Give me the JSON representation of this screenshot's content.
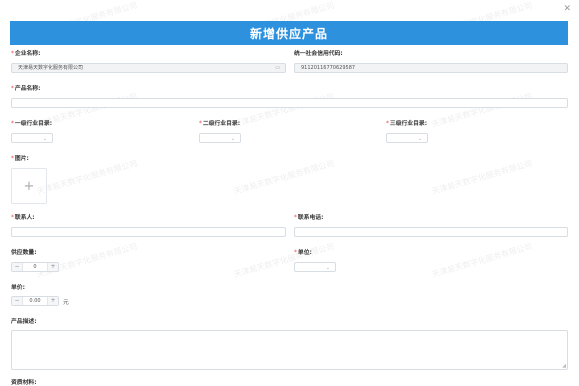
{
  "dialog": {
    "title": "新增供应产品",
    "close_icon": "close-icon"
  },
  "watermark": "天津易天数字化服务有限公司",
  "form": {
    "company_name": {
      "label": "企业名称:",
      "value": "天津易天数字化服务有限公司",
      "icon": "card-icon"
    },
    "credit_code": {
      "label": "统一社会信用代码:",
      "value": "91120116770629587"
    },
    "product_name": {
      "label": "产品名称:",
      "value": ""
    },
    "industry_level1": {
      "label": "一级行业目录:",
      "value": ""
    },
    "industry_level2": {
      "label": "二级行业目录:",
      "value": ""
    },
    "industry_level3": {
      "label": "三级行业目录:",
      "value": ""
    },
    "image": {
      "label": "图片:",
      "icon": "plus-icon"
    },
    "contact": {
      "label": "联系人:",
      "value": ""
    },
    "phone": {
      "label": "联系电话:",
      "value": ""
    },
    "supply_qty": {
      "label": "供应数量:",
      "value": "0",
      "minus": "−",
      "plus": "+"
    },
    "unit": {
      "label": "单位:",
      "value": ""
    },
    "price": {
      "label": "单价:",
      "value": "0.00",
      "minus": "−",
      "plus": "+",
      "suffix": "元"
    },
    "description": {
      "label": "产品描述:",
      "value": ""
    },
    "qualification": {
      "label": "资质材料:"
    }
  }
}
